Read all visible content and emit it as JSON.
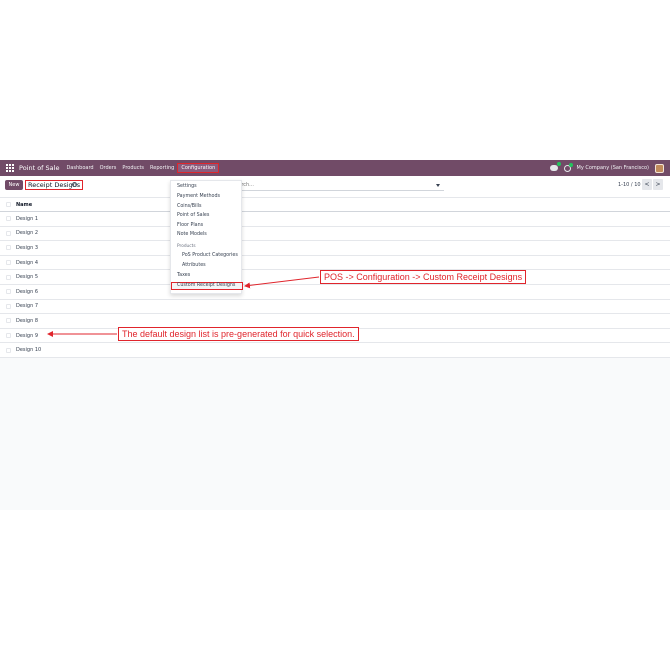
{
  "navbar": {
    "brand": "Point of Sale",
    "menu": [
      "Dashboard",
      "Orders",
      "Products",
      "Reporting",
      "Configuration"
    ],
    "company": "My Company (San Francisco)",
    "icons": [
      "apps-grid-icon",
      "chat-icon",
      "activity-clock-icon",
      "user-avatar"
    ]
  },
  "control": {
    "new_label": "New",
    "title": "Receipt Designs",
    "search_placeholder": "Search...",
    "pager": "1-10 / 10",
    "prev": "<",
    "next": ">"
  },
  "list": {
    "column": "Name",
    "rows": [
      "Design 1",
      "Design 2",
      "Design 3",
      "Design 4",
      "Design 5",
      "Design 6",
      "Design 7",
      "Design 8",
      "Design 9",
      "Design 10"
    ]
  },
  "config_menu": {
    "items": [
      "Settings",
      "Payment Methods",
      "Coins/Bills",
      "Point of Sales",
      "Floor Plans",
      "Note Models"
    ],
    "section": "Products",
    "sub_items": [
      "PoS Product Categories",
      "Attributes"
    ],
    "taxes": "Taxes",
    "highlighted": "Custom Receipt Designs"
  },
  "annotations": {
    "menu_path": "POS -> Configuration -> Custom Receipt Designs",
    "list_note": "The default design list is pre-generated for quick selection."
  },
  "colors": {
    "brand": "#714b67",
    "annotation": "#e0252c"
  }
}
